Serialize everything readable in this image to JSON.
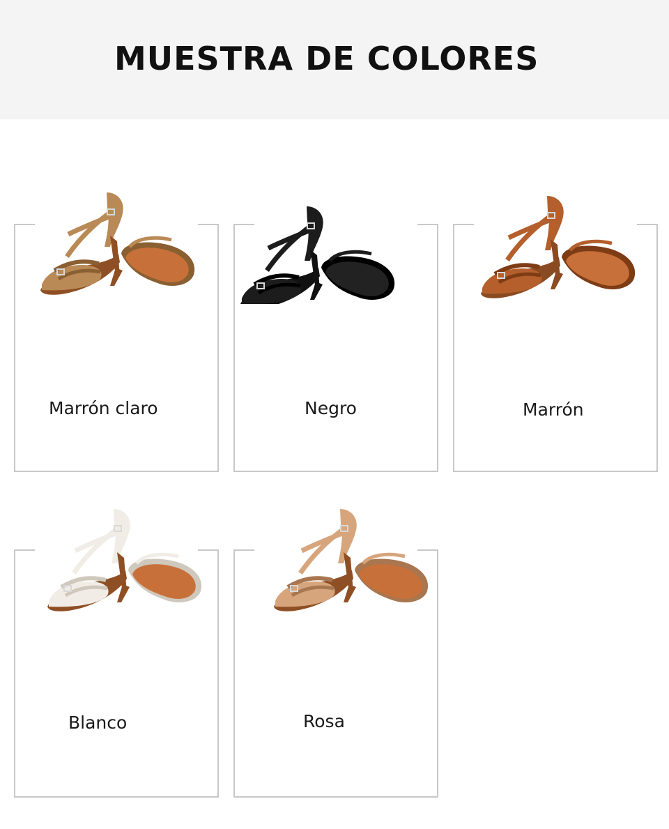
{
  "header": {
    "title": "MUESTRA DE COLORES"
  },
  "swatches": [
    {
      "label": "Marrón claro",
      "upper": "#b98a55",
      "upper_dark": "#8a5f31",
      "sole": "#c8703a",
      "heel": "#8f4f24"
    },
    {
      "label": "Negro",
      "upper": "#1c1c1c",
      "upper_dark": "#000000",
      "sole": "#222222",
      "heel": "#111111"
    },
    {
      "label": "Marrón",
      "upper": "#b45f2c",
      "upper_dark": "#7e3c15",
      "sole": "#c8703a",
      "heel": "#8a4a22"
    },
    {
      "label": "Blanco",
      "upper": "#f1ede6",
      "upper_dark": "#cfc8bc",
      "sole": "#c8703a",
      "heel": "#8f4f24"
    },
    {
      "label": "Rosa",
      "upper": "#d7a57c",
      "upper_dark": "#a8764f",
      "sole": "#c8703a",
      "heel": "#8f4f24"
    }
  ]
}
